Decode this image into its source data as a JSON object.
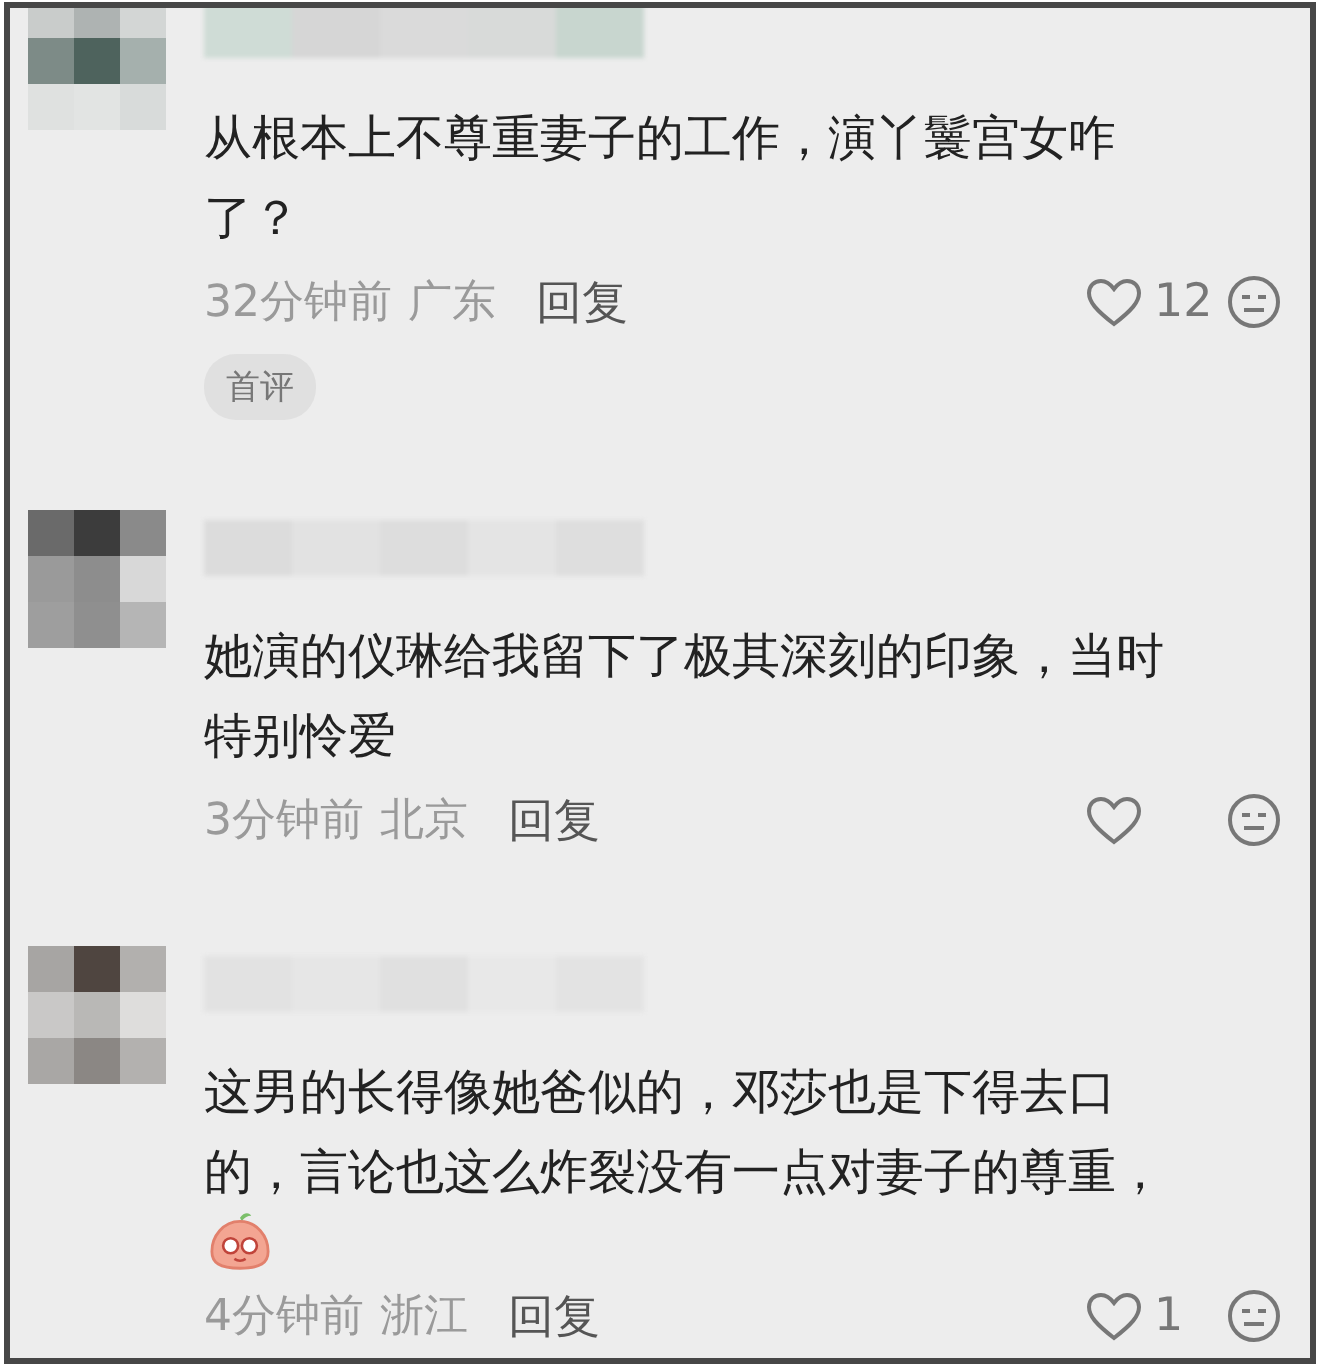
{
  "comments": [
    {
      "text": "从根本上不尊重妻子的工作，演丫鬟宫女咋了？",
      "sticker": false,
      "time": "32分钟前",
      "region": "广东",
      "reply": "回复",
      "likes": "12",
      "badge": "首评"
    },
    {
      "text": "她演的仪琳给我留下了极其深刻的印象，当时特别怜爱",
      "sticker": false,
      "time": "3分钟前",
      "region": "北京",
      "reply": "回复"
    },
    {
      "text": "这男的长得像她爸似的，邓莎也是下得去口的，言论也这么炸裂没有一点对妻子的尊重，",
      "sticker": true,
      "time": "4分钟前",
      "region": "浙江",
      "reply": "回复",
      "likes": "1"
    }
  ]
}
